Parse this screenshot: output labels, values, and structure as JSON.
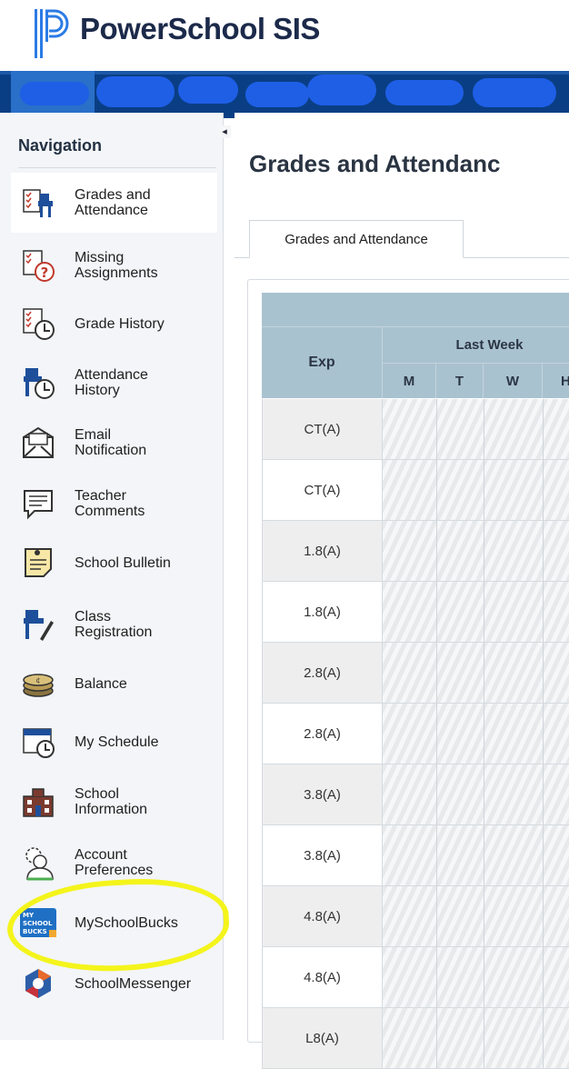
{
  "app": {
    "brand_title": "PowerSchool SIS",
    "colors": {
      "topbar": "#0a3e84",
      "redaction": "#1e5fe6",
      "sidebar_bg": "#f3f5f8",
      "table_header": "#a9c2d0",
      "highlight": "#f4f41c"
    }
  },
  "sidebar": {
    "heading": "Navigation",
    "items": [
      {
        "label": "Grades and\nAttendance",
        "icon": "grades-attendance-icon",
        "active": true
      },
      {
        "label": "Missing\nAssignments",
        "icon": "missing-assignments-icon"
      },
      {
        "label": "Grade History",
        "icon": "grade-history-icon"
      },
      {
        "label": "Attendance\nHistory",
        "icon": "attendance-history-icon"
      },
      {
        "label": "Email\nNotification",
        "icon": "email-icon"
      },
      {
        "label": "Teacher\nComments",
        "icon": "comments-icon"
      },
      {
        "label": "School Bulletin",
        "icon": "bulletin-icon"
      },
      {
        "label": "Class\nRegistration",
        "icon": "class-registration-icon"
      },
      {
        "label": "Balance",
        "icon": "balance-icon"
      },
      {
        "label": "My Schedule",
        "icon": "schedule-icon"
      },
      {
        "label": "School\nInformation",
        "icon": "school-icon"
      },
      {
        "label": "Account\nPreferences",
        "icon": "account-icon"
      },
      {
        "label": "MySchoolBucks",
        "icon": "myschoolbucks-icon"
      },
      {
        "label": "SchoolMessenger",
        "icon": "schoolmessenger-icon"
      }
    ]
  },
  "main": {
    "title": "Grades and Attendanc",
    "tab_label": "Grades and Attendance",
    "table": {
      "exp_header": "Exp",
      "last_week_header": "Last Week",
      "days": [
        "M",
        "T",
        "W",
        "H"
      ],
      "rows": [
        "CT(A)",
        "CT(A)",
        "1.8(A)",
        "1.8(A)",
        "2.8(A)",
        "2.8(A)",
        "3.8(A)",
        "3.8(A)",
        "4.8(A)",
        "4.8(A)",
        "L8(A)"
      ]
    }
  }
}
